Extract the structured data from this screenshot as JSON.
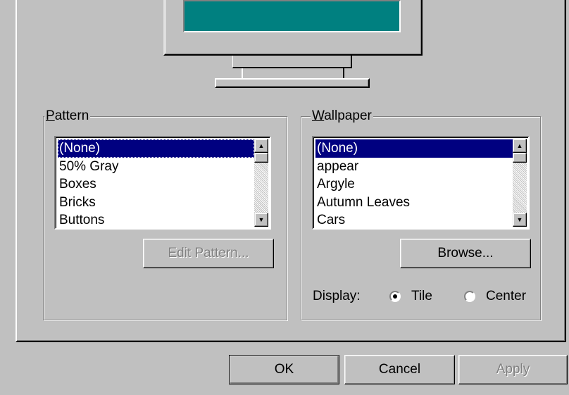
{
  "pattern_group": {
    "label": "Pattern",
    "items": [
      "(None)",
      "50% Gray",
      "Boxes",
      "Bricks",
      "Buttons"
    ],
    "selected_index": 0,
    "edit_button": "Edit Pattern..."
  },
  "wallpaper_group": {
    "label": "Wallpaper",
    "items": [
      "(None)",
      "appear",
      "Argyle",
      "Autumn Leaves",
      "Cars"
    ],
    "selected_index": 0,
    "browse_button": "Browse...",
    "display_label": "Display:",
    "display_options": [
      {
        "label": "Tile",
        "selected": true
      },
      {
        "label": "Center",
        "selected": false
      }
    ]
  },
  "dialog_buttons": {
    "ok": "OK",
    "cancel": "Cancel",
    "apply": "Apply"
  },
  "colors": {
    "desktop_preview": "#008080",
    "selection": "#000080",
    "face": "#c0c0c0"
  }
}
